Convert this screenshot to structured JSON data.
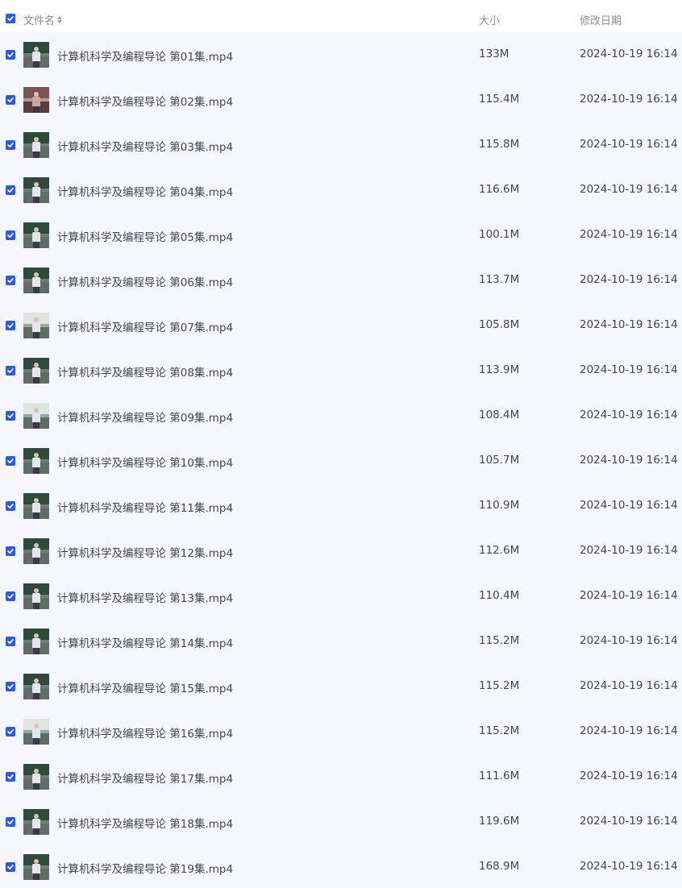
{
  "header": {
    "name_label": "文件名",
    "size_label": "大小",
    "date_label": "修改日期"
  },
  "colors": {
    "accent": "#2a5ae8",
    "row_background": "#f6f7fd",
    "header_text": "#8a8c99",
    "row_text": "#42454f"
  },
  "files": [
    {
      "name": "计算机科学及编程导论 第01集.mp4",
      "size": "133M",
      "modified": "2024-10-19 16:14",
      "selected": true
    },
    {
      "name": "计算机科学及编程导论 第02集.mp4",
      "size": "115.4M",
      "modified": "2024-10-19 16:14",
      "selected": true
    },
    {
      "name": "计算机科学及编程导论 第03集.mp4",
      "size": "115.8M",
      "modified": "2024-10-19 16:14",
      "selected": true
    },
    {
      "name": "计算机科学及编程导论 第04集.mp4",
      "size": "116.6M",
      "modified": "2024-10-19 16:14",
      "selected": true
    },
    {
      "name": "计算机科学及编程导论 第05集.mp4",
      "size": "100.1M",
      "modified": "2024-10-19 16:14",
      "selected": true
    },
    {
      "name": "计算机科学及编程导论 第06集.mp4",
      "size": "113.7M",
      "modified": "2024-10-19 16:14",
      "selected": true
    },
    {
      "name": "计算机科学及编程导论 第07集.mp4",
      "size": "105.8M",
      "modified": "2024-10-19 16:14",
      "selected": true
    },
    {
      "name": "计算机科学及编程导论 第08集.mp4",
      "size": "113.9M",
      "modified": "2024-10-19 16:14",
      "selected": true
    },
    {
      "name": "计算机科学及编程导论 第09集.mp4",
      "size": "108.4M",
      "modified": "2024-10-19 16:14",
      "selected": true
    },
    {
      "name": "计算机科学及编程导论 第10集.mp4",
      "size": "105.7M",
      "modified": "2024-10-19 16:14",
      "selected": true
    },
    {
      "name": "计算机科学及编程导论 第11集.mp4",
      "size": "110.9M",
      "modified": "2024-10-19 16:14",
      "selected": true
    },
    {
      "name": "计算机科学及编程导论 第12集.mp4",
      "size": "112.6M",
      "modified": "2024-10-19 16:14",
      "selected": true
    },
    {
      "name": "计算机科学及编程导论 第13集.mp4",
      "size": "110.4M",
      "modified": "2024-10-19 16:14",
      "selected": true
    },
    {
      "name": "计算机科学及编程导论 第14集.mp4",
      "size": "115.2M",
      "modified": "2024-10-19 16:14",
      "selected": true
    },
    {
      "name": "计算机科学及编程导论 第15集.mp4",
      "size": "115.2M",
      "modified": "2024-10-19 16:14",
      "selected": true
    },
    {
      "name": "计算机科学及编程导论 第16集.mp4",
      "size": "115.2M",
      "modified": "2024-10-19 16:14",
      "selected": true
    },
    {
      "name": "计算机科学及编程导论 第17集.mp4",
      "size": "111.6M",
      "modified": "2024-10-19 16:14",
      "selected": true
    },
    {
      "name": "计算机科学及编程导论 第18集.mp4",
      "size": "119.6M",
      "modified": "2024-10-19 16:14",
      "selected": true
    },
    {
      "name": "计算机科学及编程导论 第19集.mp4",
      "size": "168.9M",
      "modified": "2024-10-19 16:14",
      "selected": true
    }
  ]
}
